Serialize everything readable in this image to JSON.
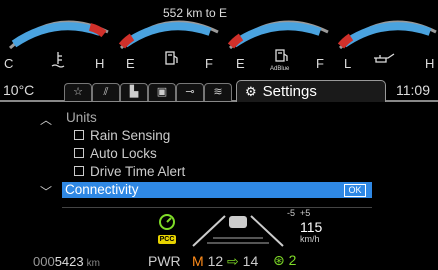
{
  "gauges": {
    "range_text": "552 km to E",
    "coolant": {
      "min_label": "C",
      "max_label": "H",
      "icon": "coolant-temp-icon"
    },
    "fuel": {
      "min_label": "E",
      "max_label": "F",
      "icon": "fuel-pump-icon"
    },
    "adblue": {
      "min_label": "E",
      "max_label": "F",
      "icon": "adblue-icon",
      "icon_text": "AdBlue"
    },
    "oil": {
      "min_label": "L",
      "max_label": "H",
      "icon": "oil-can-icon"
    },
    "colors": {
      "arc_blue": "#4aa3df",
      "arc_red": "#d0302a",
      "bezel": "#9a9a9a"
    }
  },
  "tabbar": {
    "outside_temp": "10°C",
    "clock": "11:09",
    "tabs": [
      {
        "name": "favorites-tab",
        "icon": "star-icon"
      },
      {
        "name": "trip-tab",
        "icon": "road-icon"
      },
      {
        "name": "truck-tab",
        "icon": "truck-icon"
      },
      {
        "name": "trailer-tab",
        "icon": "trailer-icon"
      },
      {
        "name": "service-tab",
        "icon": "wrench-icon"
      },
      {
        "name": "environment-tab",
        "icon": "heat-icon"
      }
    ],
    "active_tab": {
      "icon": "gears-icon",
      "label": "Settings"
    }
  },
  "menu": {
    "section_title": "Units",
    "items": [
      "Rain Sensing",
      "Auto Locks",
      "Drive Time Alert"
    ],
    "selected": {
      "label": "Connectivity",
      "action": "OK"
    },
    "colors": {
      "highlight": "#2f88e4"
    }
  },
  "status": {
    "pcc_label": "PCC",
    "speed_offsets": [
      "-5",
      "+5"
    ],
    "speed": "115",
    "speed_unit": "km/h",
    "odometer_dim": "000",
    "odometer_bright": "5423",
    "odometer_unit": "km",
    "mode": "PWR",
    "gear_mode": "M",
    "gear_current": "12",
    "gear_next": "14",
    "eco_value": "2",
    "colors": {
      "accent_green": "#7fdc28",
      "accent_orange": "#ff8c1a",
      "pcc_yellow": "#e6d200"
    }
  }
}
